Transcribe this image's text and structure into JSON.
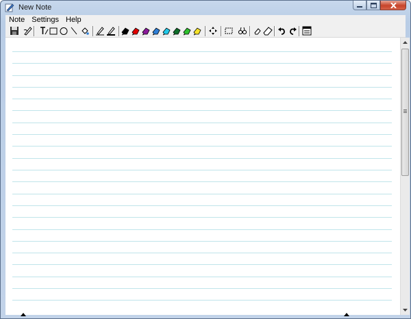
{
  "window": {
    "title": "New Note"
  },
  "menu": [
    "Note",
    "Settings",
    "Help"
  ],
  "toolbar": {
    "tools": [
      {
        "name": "save-icon",
        "interactable": true
      },
      {
        "name": "pen-settings-icon",
        "interactable": true
      },
      {
        "name": "text-tool-icon",
        "interactable": true
      },
      {
        "name": "rectangle-tool-icon",
        "interactable": true
      },
      {
        "name": "ellipse-tool-icon",
        "interactable": true
      },
      {
        "name": "line-tool-icon",
        "interactable": true
      },
      {
        "name": "fill-tool-icon",
        "interactable": true
      },
      {
        "name": "pencil-thin-icon",
        "interactable": true
      },
      {
        "name": "pencil-thick-icon",
        "interactable": true
      },
      {
        "name": "select-move-icon",
        "interactable": true
      },
      {
        "name": "select-rectangle-icon",
        "interactable": true
      },
      {
        "name": "find-icon",
        "interactable": true
      },
      {
        "name": "eraser-small-icon",
        "interactable": true
      },
      {
        "name": "eraser-large-icon",
        "interactable": true
      },
      {
        "name": "undo-icon",
        "interactable": true
      },
      {
        "name": "redo-icon",
        "interactable": true
      },
      {
        "name": "page-view-icon",
        "interactable": true
      }
    ],
    "pen_colors": [
      "#000000",
      "#e00000",
      "#8b1a9a",
      "#2f7fd6",
      "#22c8e8",
      "#0f6e2a",
      "#2ec02e",
      "#f5e22a"
    ]
  },
  "colors": {
    "ruled_line": "#bfe4ea",
    "canvas": "#ffffff",
    "chrome": "#f0f0f0",
    "close_button": "#c7442a"
  }
}
